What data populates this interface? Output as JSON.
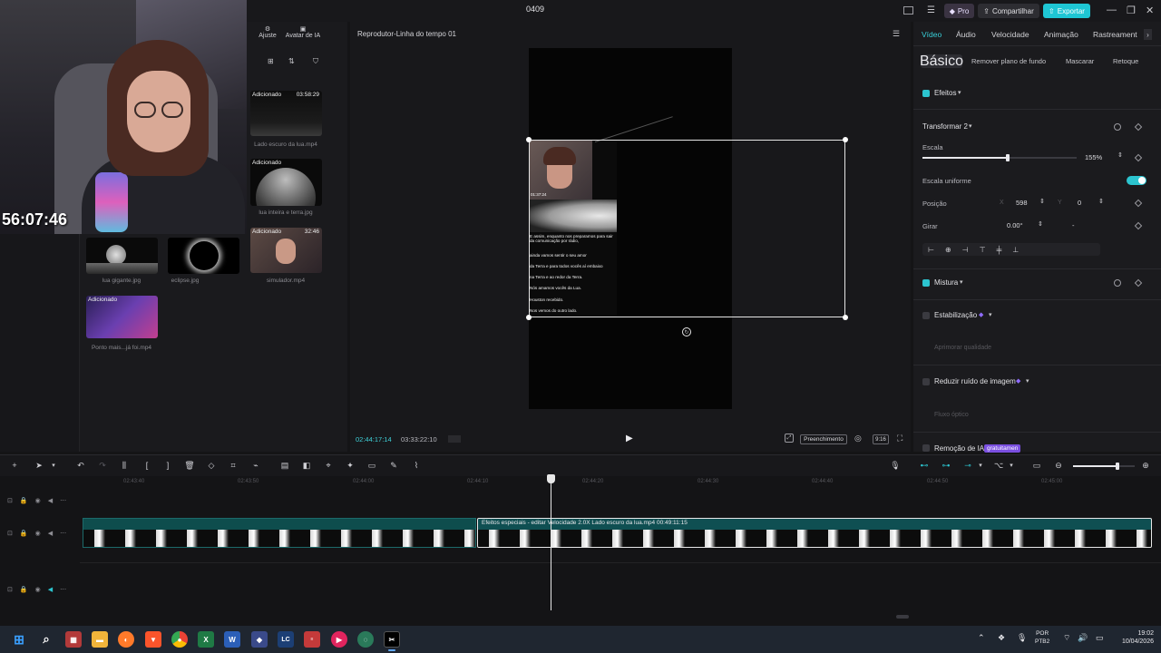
{
  "window": {
    "title": "0409",
    "pro_label": "Pro",
    "share_label": "Compartilhar",
    "export_label": "Exportar"
  },
  "webcam": {
    "clock": "56:07:46"
  },
  "media": {
    "tools": [
      {
        "label": "Ajuste",
        "icon": "sliders-icon"
      },
      {
        "label": "Avatar de IA",
        "icon": "avatar-icon"
      }
    ],
    "items": [
      {
        "name": "Lado escuro da lua.mp4",
        "tag": "Adicionado",
        "duration": "03:58:29"
      },
      {
        "name": "lua inteira e terra.jpg",
        "tag": "Adicionado",
        "duration": ""
      },
      {
        "name": "lua gigante.jpg",
        "tag": "",
        "duration": ""
      },
      {
        "name": "eclipse.jpg",
        "tag": "",
        "duration": ""
      },
      {
        "name": "simulador.mp4",
        "tag": "Adicionado",
        "duration": "32:46"
      },
      {
        "name": "Ponto mais...já foi.mp4",
        "tag": "Adicionado",
        "duration": ""
      }
    ]
  },
  "player": {
    "title": "Reprodutor-Linha do tempo 01",
    "current_time": "02:44:17:14",
    "total_time": "03:33:22:10",
    "fill_label": "Preenchimento",
    "ratio_label": "9:16",
    "overlay_time": "01:37:24",
    "subtitles": [
      "E assim, enquanto nos preparamos para sair da comunicação por rádio,",
      "ainda vamos sentir o seu amor",
      "da Terra e para todos vocês aí embaixo",
      "na Terra e ao redor da Terra.",
      "Nós amamos vocês da Lua.",
      "Houston recebido.",
      "Nos vemos do outro lado."
    ]
  },
  "inspector": {
    "tabs": [
      "Vídeo",
      "Áudio",
      "Velocidade",
      "Animação",
      "Rastreament"
    ],
    "subtabs": [
      "Básico",
      "Remover plano de fundo",
      "Mascarar",
      "Retoque"
    ],
    "effects_label": "Efeitos",
    "transform_label": "Transformar 2",
    "scale_label": "Escala",
    "scale_value": "155%",
    "scale_fraction": 0.55,
    "uniform_label": "Escala uniforme",
    "position_label": "Posição",
    "pos_x_label": "X",
    "pos_x_value": "598",
    "pos_y_label": "Y",
    "pos_y_value": "0",
    "rotate_label": "Girar",
    "rotate_value": "0.00°",
    "rotate_extra": "-",
    "blend_label": "Mistura",
    "stabilize_label": "Estabilização",
    "enhance_label": "Aprimorar qualidade",
    "noise_label": "Reduzir ruído de imagem",
    "optical_label": "Fluxo óptico",
    "ai_remove_label": "Remoção de IA",
    "ai_remove_badge": "gratuitamen"
  },
  "timeline": {
    "ticks": [
      "02:43:40",
      "02:43:50",
      "02:44:00",
      "02:44:10",
      "02:44:20",
      "02:44:30",
      "02:44:40",
      "02:44:50",
      "02:45:00"
    ],
    "clip_label": "Efeitos especiais - editar   Velocidade 2.0X   Lado escuro da lua.mp4   00:49:11:15",
    "zoom_fraction": 0.72
  },
  "taskbar": {
    "apps": [
      "windows-start",
      "search",
      "app-red",
      "file-explorer",
      "firefox",
      "brave",
      "chrome",
      "excel",
      "word",
      "app-diamond",
      "lc",
      "app-news",
      "youtube",
      "app-circle",
      "capcut"
    ],
    "lang": "POR",
    "lang_sub": "PTB2",
    "time": "19:02",
    "date": "10/04/2026"
  }
}
